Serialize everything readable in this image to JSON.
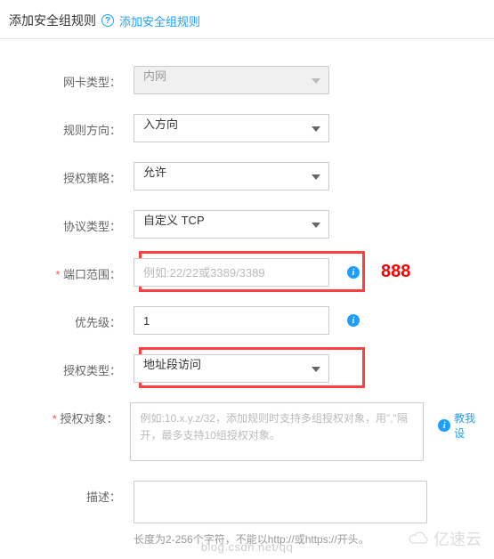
{
  "header": {
    "title": "添加安全组规则",
    "help_label": "添加安全组规则"
  },
  "form": {
    "nic_type": {
      "label": "网卡类型：",
      "value": "内网"
    },
    "direction": {
      "label": "规则方向：",
      "value": "入方向"
    },
    "auth_policy": {
      "label": "授权策略：",
      "value": "允许"
    },
    "protocol": {
      "label": "协议类型：",
      "value": "自定义 TCP"
    },
    "port_range": {
      "label": "端口范围：",
      "placeholder": "例如:22/22或3389/3389"
    },
    "priority": {
      "label": "优先级：",
      "value": "1"
    },
    "auth_type": {
      "label": "授权类型：",
      "value": "地址段访问"
    },
    "auth_object": {
      "label": "授权对象：",
      "placeholder_l1": "例如:10.x.y.z/32，添加规则时支持多组授权对象，用\",\"隔",
      "placeholder_l2": "开，最多支持10组授权对象。",
      "teach_link": "教我设"
    },
    "description": {
      "label": "描述：",
      "hint": "长度为2-256个字符，不能以http://或https://开头。"
    }
  },
  "annotations": {
    "port_note": "888"
  },
  "watermark": {
    "brand": "亿速云",
    "url": "blog.csdn.net/qq"
  }
}
